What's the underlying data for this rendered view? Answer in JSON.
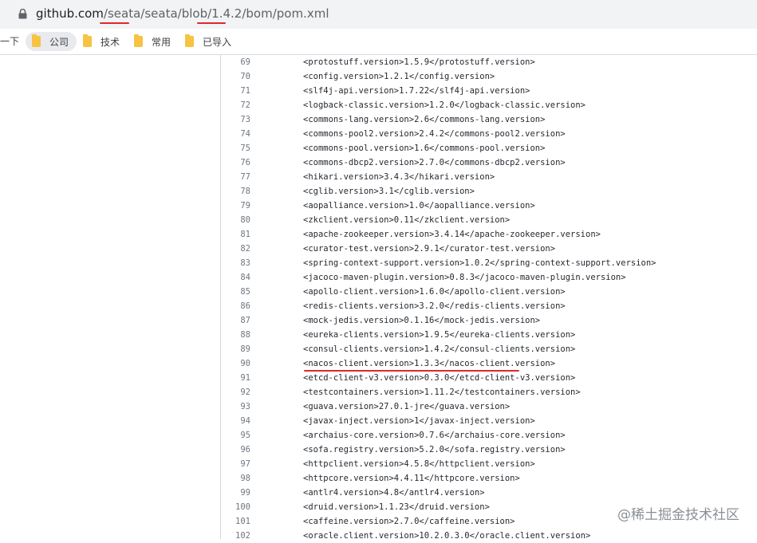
{
  "browser": {
    "url_host": "github.com",
    "url_seg_sep1": "/",
    "url_seg_owner": "seata",
    "url_seg_sep2": "/seata/blob/",
    "url_seg_version": "1.4.2",
    "url_seg_rest": "/bom/pom.xml"
  },
  "bookmarks": {
    "cut_label": "一下",
    "items": [
      "公司",
      "技术",
      "常用",
      "已导入"
    ]
  },
  "code": {
    "lines": [
      {
        "n": "69",
        "t": "<protostuff.version>1.5.9</protostuff.version>"
      },
      {
        "n": "70",
        "t": "<config.version>1.2.1</config.version>"
      },
      {
        "n": "71",
        "t": "<slf4j-api.version>1.7.22</slf4j-api.version>"
      },
      {
        "n": "72",
        "t": "<logback-classic.version>1.2.0</logback-classic.version>"
      },
      {
        "n": "73",
        "t": "<commons-lang.version>2.6</commons-lang.version>"
      },
      {
        "n": "74",
        "t": "<commons-pool2.version>2.4.2</commons-pool2.version>"
      },
      {
        "n": "75",
        "t": "<commons-pool.version>1.6</commons-pool.version>"
      },
      {
        "n": "76",
        "t": "<commons-dbcp2.version>2.7.0</commons-dbcp2.version>"
      },
      {
        "n": "77",
        "t": "<hikari.version>3.4.3</hikari.version>"
      },
      {
        "n": "78",
        "t": "<cglib.version>3.1</cglib.version>"
      },
      {
        "n": "79",
        "t": "<aopalliance.version>1.0</aopalliance.version>"
      },
      {
        "n": "80",
        "t": "<zkclient.version>0.11</zkclient.version>"
      },
      {
        "n": "81",
        "t": "<apache-zookeeper.version>3.4.14</apache-zookeeper.version>"
      },
      {
        "n": "82",
        "t": "<curator-test.version>2.9.1</curator-test.version>"
      },
      {
        "n": "83",
        "t": "<spring-context-support.version>1.0.2</spring-context-support.version>"
      },
      {
        "n": "84",
        "t": "<jacoco-maven-plugin.version>0.8.3</jacoco-maven-plugin.version>"
      },
      {
        "n": "85",
        "t": "<apollo-client.version>1.6.0</apollo-client.version>"
      },
      {
        "n": "86",
        "t": "<redis-clients.version>3.2.0</redis-clients.version>"
      },
      {
        "n": "87",
        "t": "<mock-jedis.version>0.1.16</mock-jedis.version>"
      },
      {
        "n": "88",
        "t": "<eureka-clients.version>1.9.5</eureka-clients.version>"
      },
      {
        "n": "89",
        "t": "<consul-clients.version>1.4.2</consul-clients.version>"
      },
      {
        "n": "90",
        "t": "<nacos-client.version>1.3.3</nacos-client.version>"
      },
      {
        "n": "91",
        "t": "<etcd-client-v3.version>0.3.0</etcd-client-v3.version>"
      },
      {
        "n": "92",
        "t": "<testcontainers.version>1.11.2</testcontainers.version>"
      },
      {
        "n": "93",
        "t": "<guava.version>27.0.1-jre</guava.version>"
      },
      {
        "n": "94",
        "t": "<javax-inject.version>1</javax-inject.version>"
      },
      {
        "n": "95",
        "t": "<archaius-core.version>0.7.6</archaius-core.version>"
      },
      {
        "n": "96",
        "t": "<sofa.registry.version>5.2.0</sofa.registry.version>"
      },
      {
        "n": "97",
        "t": "<httpclient.version>4.5.8</httpclient.version>"
      },
      {
        "n": "98",
        "t": "<httpcore.version>4.4.11</httpcore.version>"
      },
      {
        "n": "99",
        "t": "<antlr4.version>4.8</antlr4.version>"
      },
      {
        "n": "100",
        "t": "<druid.version>1.1.23</druid.version>"
      },
      {
        "n": "101",
        "t": "<caffeine.version>2.7.0</caffeine.version>"
      },
      {
        "n": "102",
        "t": "<oracle.client.version>10.2.0.3.0</oracle.client.version>"
      }
    ]
  },
  "watermark": "@稀土掘金技术社区",
  "colors": {
    "annotation_underline": "#e0282b"
  }
}
